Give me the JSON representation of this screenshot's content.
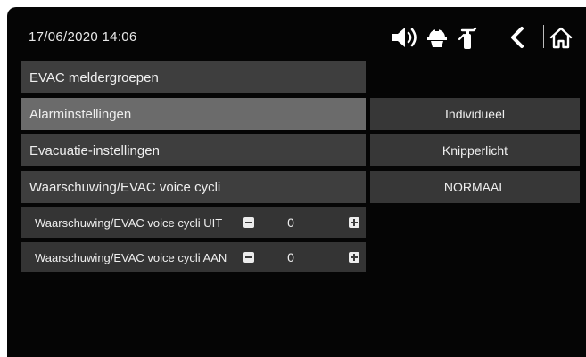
{
  "status_bar": {
    "datetime": "17/06/2020  14:06",
    "icons": [
      "night-mode-icon",
      "speaker-icon",
      "fire-helmet-icon",
      "fire-extinguisher-icon",
      "back-icon",
      "home-icon"
    ]
  },
  "menu": {
    "evac_groups": "EVAC meldergroepen",
    "alarm_settings": "Alarminstellingen",
    "evacuation_settings": "Evacuatie-instellingen",
    "warning_cycles": "Waarschuwing/EVAC voice cycli"
  },
  "steppers": [
    {
      "label": "Waarschuwing/EVAC voice cycli UIT",
      "value": "0"
    },
    {
      "label": "Waarschuwing/EVAC voice cycli AAN",
      "value": "0"
    }
  ],
  "options": {
    "individueel": "Individueel",
    "knipperlicht": "Knipperlicht",
    "normaal": "NORMAAL"
  },
  "colors": {
    "background": "#050505",
    "row_dark": "#3e3e3e",
    "row_selected": "#6b6b6b",
    "text": "#efefef"
  }
}
